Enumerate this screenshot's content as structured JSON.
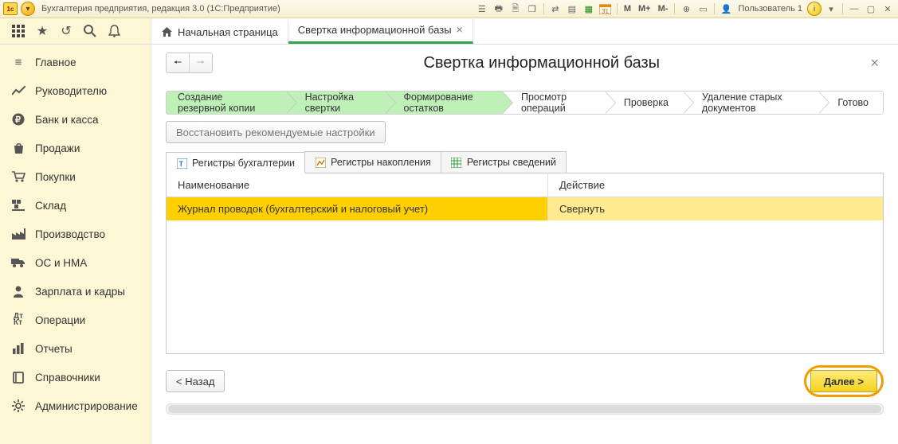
{
  "titlebar": {
    "app_title": "Бухгалтерия предприятия, редакция 3.0  (1С:Предприятие)",
    "user_label": "Пользователь 1",
    "m_labels": [
      "M",
      "M+",
      "M-"
    ]
  },
  "tabs": {
    "home": "Начальная страница",
    "active": "Свертка информационной базы"
  },
  "sidebar": {
    "items": [
      {
        "icon": "star",
        "label": "Главное"
      },
      {
        "icon": "trend",
        "label": "Руководителю"
      },
      {
        "icon": "ruble",
        "label": "Банк и касса"
      },
      {
        "icon": "bag",
        "label": "Продажи"
      },
      {
        "icon": "cart",
        "label": "Покупки"
      },
      {
        "icon": "pallet",
        "label": "Склад"
      },
      {
        "icon": "factory",
        "label": "Производство"
      },
      {
        "icon": "truck",
        "label": "ОС и НМА"
      },
      {
        "icon": "person",
        "label": "Зарплата и кадры"
      },
      {
        "icon": "dtkt",
        "label": "Операции"
      },
      {
        "icon": "bars",
        "label": "Отчеты"
      },
      {
        "icon": "book",
        "label": "Справочники"
      },
      {
        "icon": "gear",
        "label": "Администрирование"
      }
    ]
  },
  "content": {
    "page_title": "Свертка информационной базы",
    "wizard_steps": [
      "Создание резервной копии",
      "Настройка свертки",
      "Формирование остатков",
      "Просмотр операций",
      "Проверка",
      "Удаление старых документов",
      "Готово"
    ],
    "wizard_done_count": 3,
    "restore_btn": "Восстановить рекомендуемые настройки",
    "inner_tabs": [
      "Регистры бухгалтерии",
      "Регистры накопления",
      "Регистры сведений"
    ],
    "table": {
      "headers": [
        "Наименование",
        "Действие"
      ],
      "rows": [
        {
          "name": "Журнал проводок (бухгалтерский и налоговый учет)",
          "action": "Свернуть"
        }
      ]
    },
    "back_btn": "< Назад",
    "next_btn": "Далее >"
  }
}
